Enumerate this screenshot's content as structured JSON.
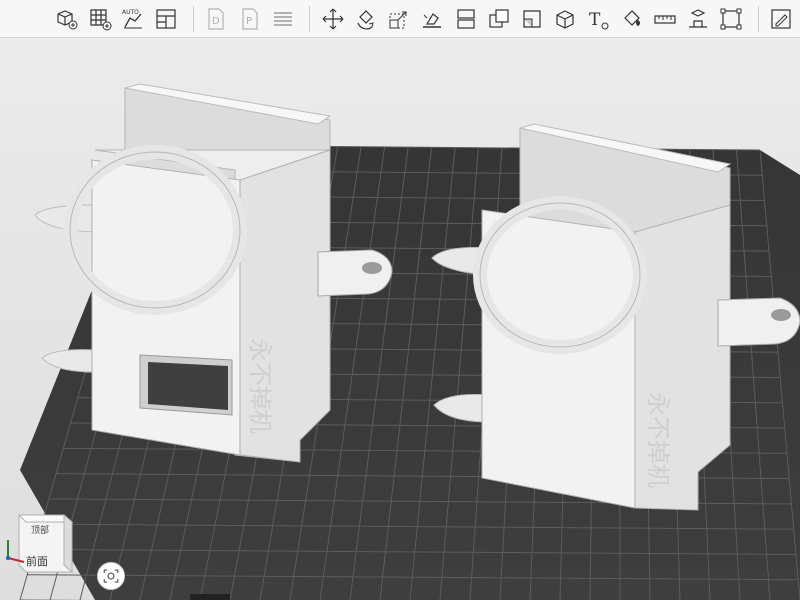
{
  "toolbar": {
    "buttons": [
      {
        "name": "add-object-icon",
        "disabled": false
      },
      {
        "name": "grid-add-icon",
        "disabled": false
      },
      {
        "name": "auto-layout-icon",
        "disabled": false,
        "text": "AUTO"
      },
      {
        "name": "layout-panel-icon",
        "disabled": false
      },
      {
        "name": "document-d-icon",
        "disabled": true,
        "text": "D"
      },
      {
        "name": "document-p-icon",
        "disabled": true,
        "text": "P"
      },
      {
        "name": "list-icon",
        "disabled": true
      },
      {
        "name": "move-icon",
        "disabled": false
      },
      {
        "name": "rotate-icon",
        "disabled": false
      },
      {
        "name": "scale-icon",
        "disabled": false
      },
      {
        "name": "lay-flat-icon",
        "disabled": false
      },
      {
        "name": "split-icon",
        "disabled": false
      },
      {
        "name": "boolean-icon",
        "disabled": false
      },
      {
        "name": "cut-icon",
        "disabled": false
      },
      {
        "name": "cube-icon",
        "disabled": false
      },
      {
        "name": "text-icon",
        "disabled": false,
        "text": "T"
      },
      {
        "name": "paint-icon",
        "disabled": false
      },
      {
        "name": "measure-icon",
        "disabled": false
      },
      {
        "name": "support-icon",
        "disabled": false
      },
      {
        "name": "bounding-box-icon",
        "disabled": false
      },
      {
        "name": "edit-icon",
        "disabled": false
      }
    ]
  },
  "models": [
    {
      "name": "left-model",
      "engraving": "永不掉机"
    },
    {
      "name": "right-model",
      "engraving": "永不掉机"
    }
  ],
  "view_cube": {
    "top_label": "顶部",
    "front_label": "前面"
  },
  "colors": {
    "plate": "#3a3a3a",
    "grid": "#5a5a5a",
    "model": "#e8e8e8",
    "background": "#e4e4e4"
  }
}
